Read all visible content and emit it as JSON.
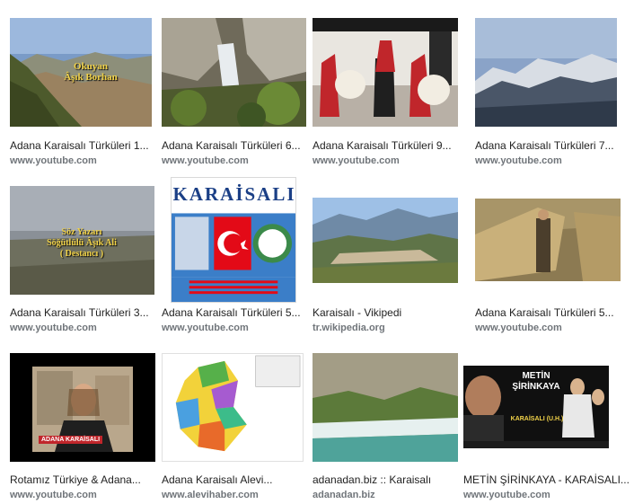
{
  "results": [
    {
      "title": "Adana Karaisalı Türküleri 1...",
      "source": "www.youtube.com",
      "overlay": [
        "Okuyan",
        "Âşık Borhan"
      ]
    },
    {
      "title": "Adana Karaisalı Türküleri 6...",
      "source": "www.youtube.com"
    },
    {
      "title": "Adana Karaisalı Türküleri 9...",
      "source": "www.youtube.com"
    },
    {
      "title": "Adana Karaisalı Türküleri 7...",
      "source": "www.youtube.com"
    },
    {
      "title": "Adana Karaisalı Türküleri 3...",
      "source": "www.youtube.com",
      "overlay": [
        "Söz Yazarı",
        "Söğütlülü Âşık Ali",
        "( Destancı )"
      ]
    },
    {
      "title": "Adana Karaisalı Türküleri 5...",
      "source": "www.youtube.com",
      "overlay": [
        "KARAİSALI"
      ]
    },
    {
      "title": "Karaisalı - Vikipedi",
      "source": "tr.wikipedia.org"
    },
    {
      "title": "Adana Karaisalı Türküleri 5...",
      "source": "www.youtube.com"
    },
    {
      "title": "Rotamız Türkiye & Adana...",
      "source": "www.youtube.com",
      "overlay": [
        "ADANA KARAİSALI"
      ]
    },
    {
      "title": "Adana Karaisalı Alevi...",
      "source": "www.alevihaber.com"
    },
    {
      "title": "adanadan.biz :: Karaisalı",
      "source": "adanadan.biz"
    },
    {
      "title": "METİN ŞİRİNKAYA - KARAİSALI...",
      "source": "www.youtube.com",
      "overlay": [
        "METİN",
        "ŞİRİNKAYA",
        "KARAİSALI (U.H.)"
      ]
    }
  ]
}
